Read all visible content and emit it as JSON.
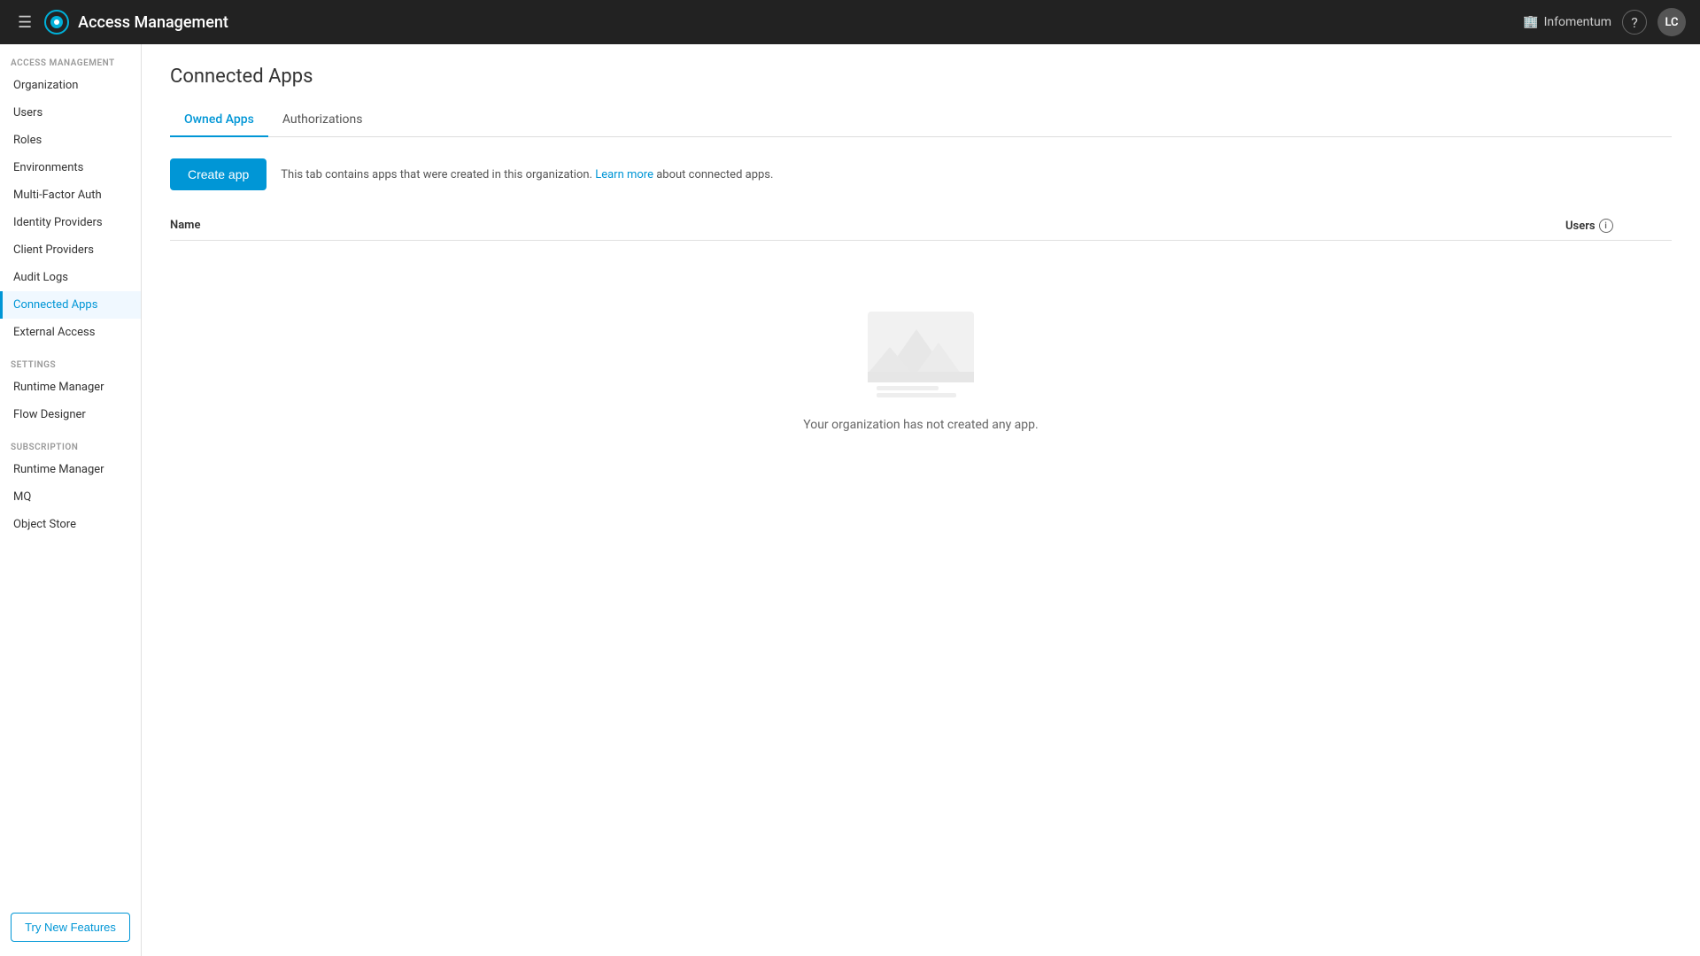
{
  "topbar": {
    "title": "Access Management",
    "org_name": "Infomentum",
    "help_label": "?",
    "avatar_label": "LC",
    "hamburger_icon": "☰"
  },
  "sidebar": {
    "section_access": "ACCESS MANAGEMENT",
    "section_settings": "SETTINGS",
    "section_subscription": "SUBSCRIPTION",
    "items_access": [
      {
        "label": "Organization",
        "id": "organization",
        "active": false
      },
      {
        "label": "Users",
        "id": "users",
        "active": false
      },
      {
        "label": "Roles",
        "id": "roles",
        "active": false
      },
      {
        "label": "Environments",
        "id": "environments",
        "active": false
      },
      {
        "label": "Multi-Factor Auth",
        "id": "mfa",
        "active": false
      },
      {
        "label": "Identity Providers",
        "id": "identity-providers",
        "active": false
      },
      {
        "label": "Client Providers",
        "id": "client-providers",
        "active": false
      },
      {
        "label": "Audit Logs",
        "id": "audit-logs",
        "active": false
      },
      {
        "label": "Connected Apps",
        "id": "connected-apps",
        "active": true
      },
      {
        "label": "External Access",
        "id": "external-access",
        "active": false
      }
    ],
    "items_settings": [
      {
        "label": "Runtime Manager",
        "id": "runtime-manager-settings",
        "active": false
      },
      {
        "label": "Flow Designer",
        "id": "flow-designer",
        "active": false
      }
    ],
    "items_subscription": [
      {
        "label": "Runtime Manager",
        "id": "runtime-manager-sub",
        "active": false
      },
      {
        "label": "MQ",
        "id": "mq",
        "active": false
      },
      {
        "label": "Object Store",
        "id": "object-store",
        "active": false
      }
    ],
    "try_new_features_label": "Try New Features"
  },
  "main": {
    "page_title": "Connected Apps",
    "tabs": [
      {
        "label": "Owned Apps",
        "id": "owned-apps",
        "active": true
      },
      {
        "label": "Authorizations",
        "id": "authorizations",
        "active": false
      }
    ],
    "create_app_label": "Create app",
    "description_text": "This tab contains apps that were created in this organization.",
    "learn_more_label": "Learn more",
    "description_suffix": "about connected apps.",
    "table": {
      "col_name": "Name",
      "col_users": "Users"
    },
    "empty_state_text": "Your organization has not created any app."
  }
}
